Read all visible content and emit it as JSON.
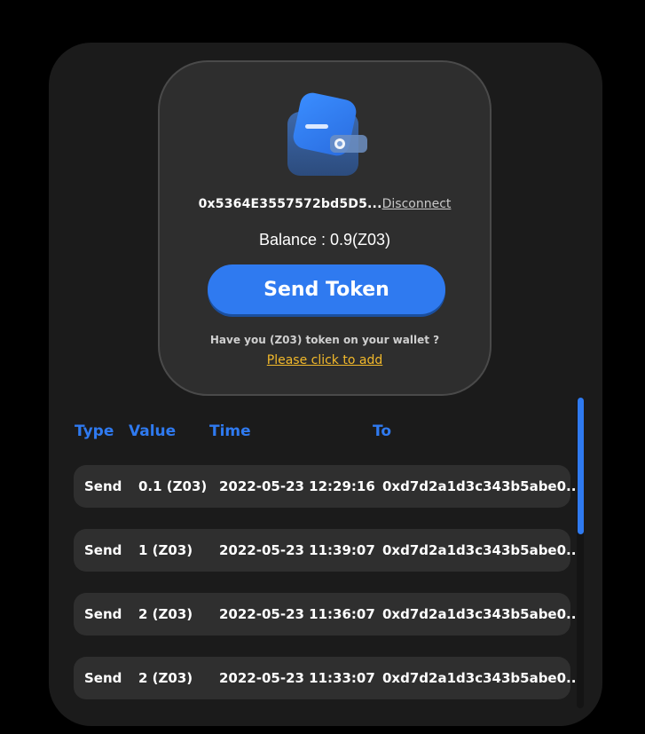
{
  "wallet": {
    "icon": "wallet-icon",
    "address": "0x5364E3557572bd5D5...",
    "disconnect_label": "Disconnect",
    "balance_text": "Balance : 0.9(Z03)",
    "send_button_label": "Send Token",
    "hint_text": "Have you (Z03) token on your wallet ?",
    "add_link_label": "Please click to add"
  },
  "table": {
    "headers": {
      "type": "Type",
      "value": "Value",
      "time": "Time",
      "to": "To"
    },
    "rows": [
      {
        "type": "Send",
        "value": "0.1 (Z03)",
        "time": "2022-05-23 12:29:16",
        "to": "0xd7d2a1d3c343b5abe0..."
      },
      {
        "type": "Send",
        "value": "1 (Z03)",
        "time": "2022-05-23 11:39:07",
        "to": "0xd7d2a1d3c343b5abe0..."
      },
      {
        "type": "Send",
        "value": "2 (Z03)",
        "time": "2022-05-23 11:36:07",
        "to": "0xd7d2a1d3c343b5abe0..."
      },
      {
        "type": "Send",
        "value": "2 (Z03)",
        "time": "2022-05-23 11:33:07",
        "to": "0xd7d2a1d3c343b5abe0..."
      }
    ]
  },
  "colors": {
    "accent": "#2f7af0",
    "link": "#f2b92b",
    "card": "#2e2e2e",
    "panel": "#1b1b1b"
  }
}
